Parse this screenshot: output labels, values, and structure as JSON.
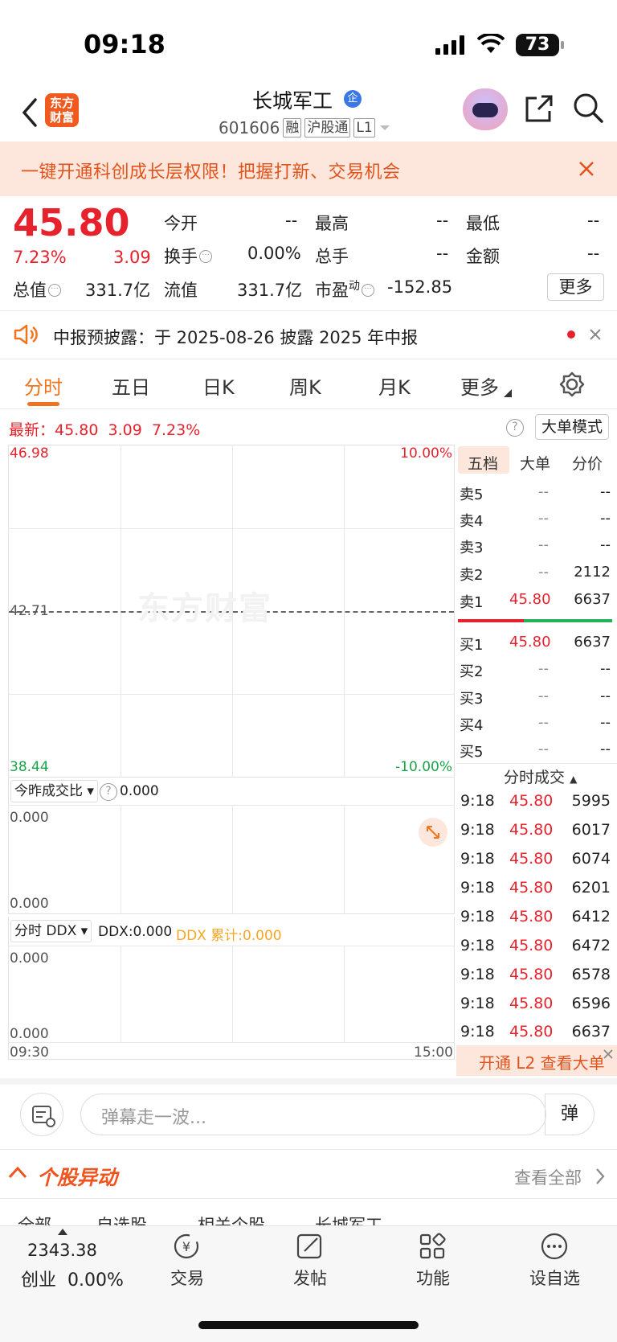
{
  "status_bar": {
    "time": "09:18",
    "battery": "73"
  },
  "header": {
    "logo_line1": "东方",
    "logo_line2": "财富",
    "stock_name": "长城军工",
    "badge": "企",
    "code": "601606",
    "tags": [
      "融",
      "沪股通",
      "L1"
    ]
  },
  "banner": {
    "text": "一键开通科创成长层权限！把握打新、交易机会"
  },
  "quote": {
    "price": "45.80",
    "change_pct": "7.23%",
    "change": "3.09",
    "fields": [
      {
        "label": "今开",
        "value": "--"
      },
      {
        "label": "最高",
        "value": "--"
      },
      {
        "label": "最低",
        "value": "--"
      },
      {
        "label": "换手",
        "value": "0.00%"
      },
      {
        "label": "总手",
        "value": "--"
      },
      {
        "label": "金额",
        "value": "--"
      },
      {
        "label": "总值",
        "value": "331.7亿"
      },
      {
        "label": "流值",
        "value": "331.7亿"
      },
      {
        "label": "市盈",
        "sup": "动",
        "value": "-152.85"
      }
    ],
    "more": "更多"
  },
  "notice": {
    "text": "中报预披露：于 2025-08-26 披露 2025 年中报"
  },
  "tabs": [
    "分时",
    "五日",
    "日K",
    "周K",
    "月K",
    "更多"
  ],
  "latest": {
    "label": "最新：",
    "price": "45.80",
    "change": "3.09",
    "pct": "7.23%"
  },
  "mode_button": "大单模式",
  "chart": {
    "y_top": "46.98",
    "y_mid": "42.71",
    "y_bottom": "38.44",
    "pct_top": "10.00%",
    "pct_bottom": "-10.00%",
    "watermark": "东方财富",
    "x_start": "09:30",
    "x_end": "15:00"
  },
  "volume_panel": {
    "selector": "今昨成交比",
    "value": "0.000",
    "y_top": "0.000",
    "y_bottom": "0.000"
  },
  "ddx_panel": {
    "selector": "分时 DDX",
    "ddx": "DDX:0.000",
    "ddx_cum": "DDX 累计:0.000",
    "y_top": "0.000",
    "y_bottom": "0.000"
  },
  "order_book": {
    "tabs": [
      "五档",
      "大单",
      "分价"
    ],
    "asks": [
      {
        "label": "卖5",
        "price": "--",
        "vol": "--"
      },
      {
        "label": "卖4",
        "price": "--",
        "vol": "--"
      },
      {
        "label": "卖3",
        "price": "--",
        "vol": "--"
      },
      {
        "label": "卖2",
        "price": "--",
        "vol": "2112"
      },
      {
        "label": "卖1",
        "price": "45.80",
        "vol": "6637"
      }
    ],
    "bids": [
      {
        "label": "买1",
        "price": "45.80",
        "vol": "6637"
      },
      {
        "label": "买2",
        "price": "--",
        "vol": "--"
      },
      {
        "label": "买3",
        "price": "--",
        "vol": "--"
      },
      {
        "label": "买4",
        "price": "--",
        "vol": "--"
      },
      {
        "label": "买5",
        "price": "--",
        "vol": "--"
      }
    ]
  },
  "ticks": {
    "title": "分时成交",
    "rows": [
      {
        "t": "9:18",
        "p": "45.80",
        "v": "5995"
      },
      {
        "t": "9:18",
        "p": "45.80",
        "v": "6017"
      },
      {
        "t": "9:18",
        "p": "45.80",
        "v": "6074"
      },
      {
        "t": "9:18",
        "p": "45.80",
        "v": "6201"
      },
      {
        "t": "9:18",
        "p": "45.80",
        "v": "6412"
      },
      {
        "t": "9:18",
        "p": "45.80",
        "v": "6472"
      },
      {
        "t": "9:18",
        "p": "45.80",
        "v": "6578"
      },
      {
        "t": "9:18",
        "p": "45.80",
        "v": "6596"
      },
      {
        "t": "9:18",
        "p": "45.80",
        "v": "6637"
      }
    ],
    "l2": "开通 L2 查看大单"
  },
  "danmaku": {
    "placeholder": "弹幕走一波...",
    "button": "弹"
  },
  "section": {
    "title": "个股异动",
    "view_all": "查看全部",
    "subtabs": [
      "全部",
      "自选股",
      "相关个股",
      "长城军工"
    ]
  },
  "bottom_bar": {
    "index_value": "2343.38",
    "index_name": "创业",
    "index_pct": "0.00%",
    "items": [
      "交易",
      "发帖",
      "功能",
      "设自选"
    ]
  }
}
